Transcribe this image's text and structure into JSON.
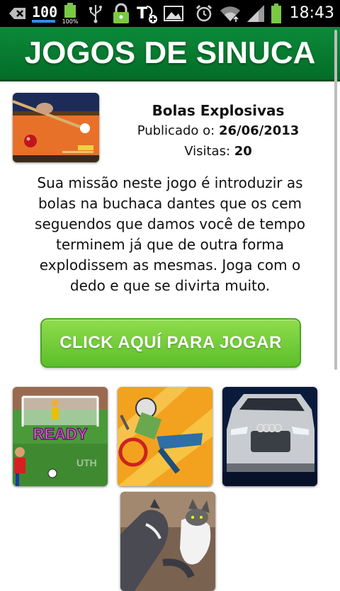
{
  "statusbar": {
    "time": "18:43",
    "battery_small_label": "100%",
    "icons": [
      "back-icon",
      "data-100-icon",
      "battery-small-icon",
      "usb-icon",
      "lock-icon",
      "t-plus-icon",
      "image-icon",
      "alarm-icon",
      "wifi-icon",
      "signal-icon",
      "battery-icon"
    ]
  },
  "header": {
    "title": "JOGOS DE SINUCA"
  },
  "game": {
    "title": "Bolas Explosivas",
    "published_label": "Publicado o:",
    "published_date": "26/06/2013",
    "visits_label": "Visitas:",
    "visits_count": "20",
    "description": "Sua missão neste jogo é introduzir as bolas na buchaca dantes que os cem seguendos que damos você de tempo terminem já que de outra forma explodissem as mesmas. Joga com o dedo e que se divirta muito."
  },
  "play_button": {
    "label": "CLICK AQUÍ PARA JOGAR"
  },
  "related_games": [
    {
      "icon": "soccer-penalty-thumbnail",
      "overlay_text": "READY"
    },
    {
      "icon": "bmx-rider-thumbnail"
    },
    {
      "icon": "silver-suv-thumbnail"
    },
    {
      "icon": "dog-and-cat-thumbnail"
    }
  ],
  "colors": {
    "header_green": "#0b8a3a",
    "button_green": "#6fcf35",
    "text": "#111111"
  }
}
